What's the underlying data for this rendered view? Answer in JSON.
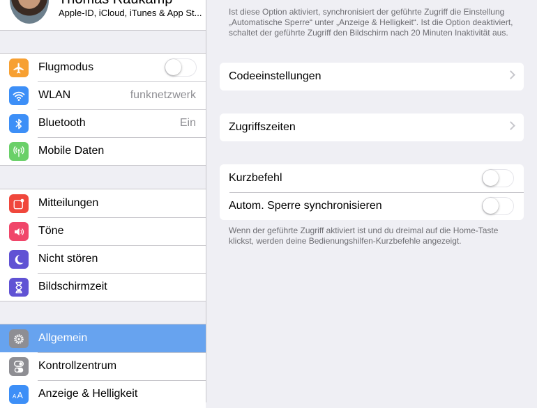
{
  "profile": {
    "name": "Thomas Raukamp",
    "subtitle": "Apple-ID, iCloud, iTunes & App St..."
  },
  "sidebar": {
    "groups": [
      {
        "items": [
          {
            "label": "Flugmodus",
            "icon": "airplane-icon",
            "color": "#f7a032",
            "toggle": "off"
          },
          {
            "label": "WLAN",
            "icon": "wifi-icon",
            "color": "#3d8ff7",
            "value": "funknetzwerk"
          },
          {
            "label": "Bluetooth",
            "icon": "bluetooth-icon",
            "color": "#3d8ff7",
            "value": "Ein"
          },
          {
            "label": "Mobile Daten",
            "icon": "antenna-icon",
            "color": "#6ad069"
          }
        ]
      },
      {
        "items": [
          {
            "label": "Mitteilungen",
            "icon": "notifications-icon",
            "color": "#f0473c"
          },
          {
            "label": "Töne",
            "icon": "speaker-icon",
            "color": "#f0466a"
          },
          {
            "label": "Nicht stören",
            "icon": "moon-icon",
            "color": "#6052d4"
          },
          {
            "label": "Bildschirmzeit",
            "icon": "hourglass-icon",
            "color": "#6052d4"
          }
        ]
      },
      {
        "items": [
          {
            "label": "Allgemein",
            "icon": "gear-icon",
            "color": "#8e8e93",
            "selected": true
          },
          {
            "label": "Kontrollzentrum",
            "icon": "switches-icon",
            "color": "#8e8e93"
          },
          {
            "label": "Anzeige & Helligkeit",
            "icon": "text-size-icon",
            "color": "#3d8ff7"
          }
        ]
      }
    ]
  },
  "detail": {
    "top_note": "Ist diese Option aktiviert, synchronisiert der geführte Zugriff die Einstellung „Automatische Sperre“ unter „Anzeige & Helligkeit“. Ist die Option deaktiviert, schaltet der geführte Zugriff den Bildschirm nach 20 Minuten Inaktivität aus.",
    "passcode_label": "Codeeinstellungen",
    "time_limits_label": "Zugriffszeiten",
    "shortcut_label": "Kurzbefehl",
    "shortcut_toggle": "off",
    "autolock_label": "Autom. Sperre synchronisieren",
    "autolock_toggle": "off",
    "bottom_note": "Wenn der geführte Zugriff aktiviert ist und du dreimal auf die Home-Taste klickst, werden deine Bedienungshilfen-Kurzbefehle angezeigt."
  }
}
